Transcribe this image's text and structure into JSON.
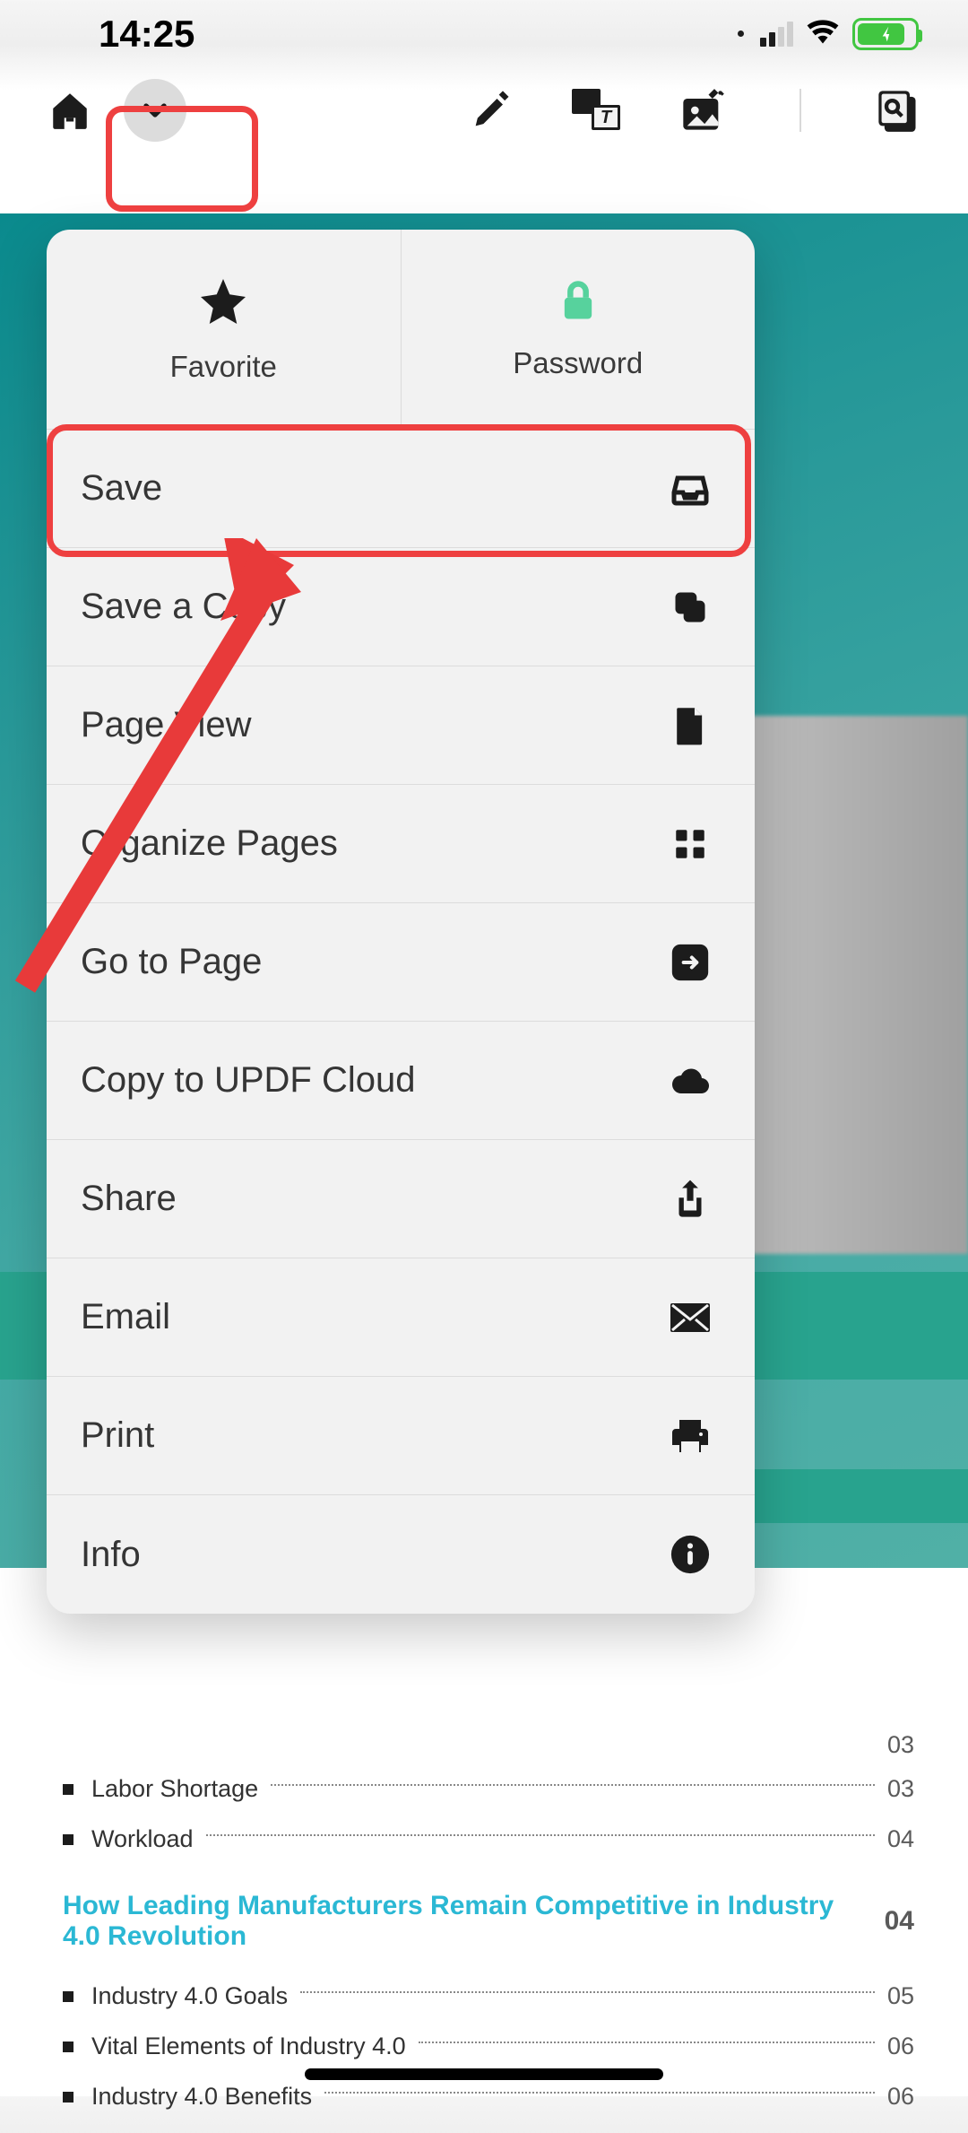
{
  "status": {
    "time": "14:25"
  },
  "dropdown": {
    "top": {
      "favorite": "Favorite",
      "password": "Password"
    },
    "items": [
      {
        "label": "Save",
        "icon": "inbox"
      },
      {
        "label": "Save a Copy",
        "icon": "copy"
      },
      {
        "label": "Page View",
        "icon": "page"
      },
      {
        "label": "Organize Pages",
        "icon": "grid"
      },
      {
        "label": "Go to Page",
        "icon": "arrow"
      },
      {
        "label": "Copy to UPDF Cloud",
        "icon": "cloud"
      },
      {
        "label": "Share",
        "icon": "share"
      },
      {
        "label": "Email",
        "icon": "mail"
      },
      {
        "label": "Print",
        "icon": "print"
      },
      {
        "label": "Info",
        "icon": "info"
      }
    ]
  },
  "toc": {
    "items_a": [
      {
        "label": "Labor Shortage",
        "page": "03"
      },
      {
        "label": "Workload",
        "page": "04"
      }
    ],
    "stray_page": "03",
    "heading": {
      "text": "How Leading Manufacturers Remain Competitive in Industry 4.0 Revolution",
      "page": "04"
    },
    "items_b": [
      {
        "label": "Industry 4.0 Goals",
        "page": "05"
      },
      {
        "label": "Vital Elements of Industry 4.0",
        "page": "06"
      },
      {
        "label": "Industry 4.0 Benefits",
        "page": "06"
      }
    ]
  }
}
